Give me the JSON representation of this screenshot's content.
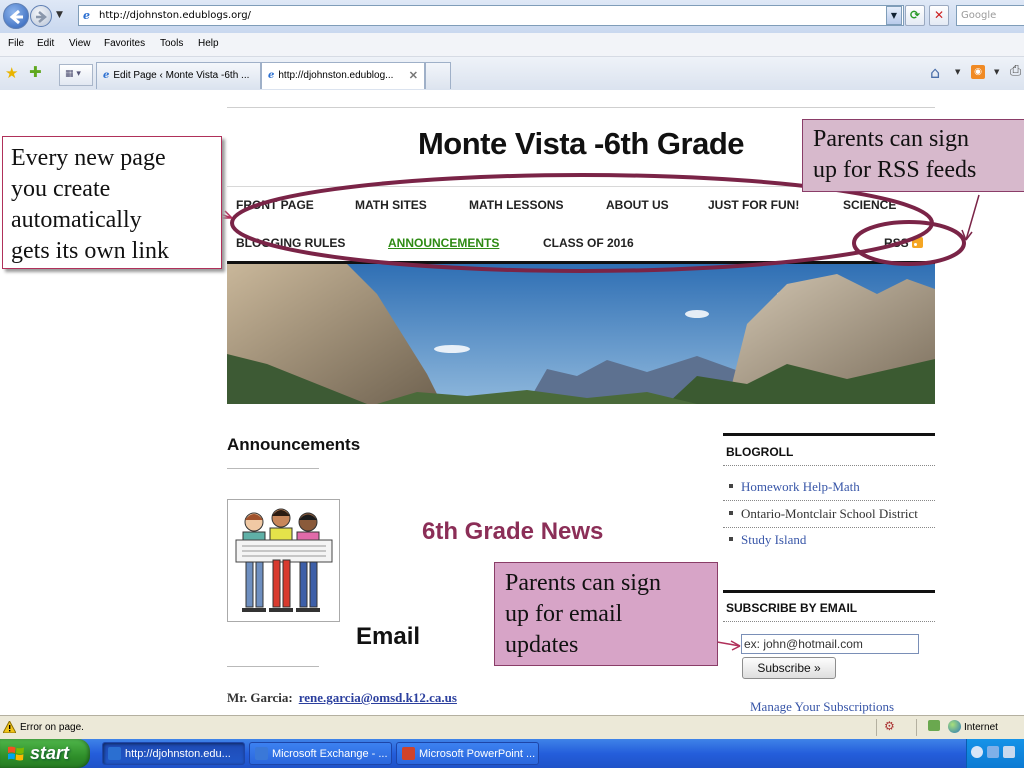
{
  "browser": {
    "url": "http://djohnston.edublogs.org/",
    "search_placeholder": "Google",
    "menu": [
      "File",
      "Edit",
      "View",
      "Favorites",
      "Tools",
      "Help"
    ],
    "tabs": [
      {
        "label": "Edit Page ‹ Monte Vista -6th ..."
      },
      {
        "label": "http://djohnston.edublog..."
      }
    ],
    "status_text": "Error on page.",
    "zone_text": "Internet"
  },
  "site": {
    "title": "Monte Vista -6th Grade",
    "nav_row1": [
      "FRONT PAGE",
      "MATH SITES",
      "MATH LESSONS",
      "ABOUT US",
      "JUST FOR FUN!",
      "SCIENCE"
    ],
    "nav_row2": [
      "BLOGGING RULES",
      "ANNOUNCEMENTS",
      "CLASS OF 2016"
    ],
    "nav_active": "ANNOUNCEMENTS",
    "rss_label": "RSS",
    "section_title": "Announcements",
    "news_title": "6th Grade News",
    "email_title": "Email",
    "contact_name": "Mr. Garcia:",
    "contact_email": "rene.garcia@omsd.k12.ca.us"
  },
  "sidebar": {
    "blogroll_title": "BLOGROLL",
    "blogroll": [
      {
        "label": "Homework Help-Math",
        "link": true
      },
      {
        "label": "Ontario-Montclair School District",
        "link": false
      },
      {
        "label": "Study Island",
        "link": true
      }
    ],
    "subscribe_title": "SUBSCRIBE BY EMAIL",
    "email_placeholder": "ex: john@hotmail.com",
    "subscribe_button": "Subscribe »",
    "manage_link": "Manage Your Subscriptions"
  },
  "callouts": {
    "left": [
      "Every new page",
      "you create",
      "automatically",
      "gets its own link"
    ],
    "rss": [
      "Parents can sign",
      "up for RSS feeds"
    ],
    "email": [
      "Parents can sign",
      "up for email",
      "updates"
    ]
  },
  "taskbar": {
    "start_label": "start",
    "tasks": [
      {
        "label": "http://djohnston.edu...",
        "icon_color": "#2b6fd1"
      },
      {
        "label": "Microsoft Exchange - ...",
        "icon_color": "#3a78d8"
      },
      {
        "label": "Microsoft PowerPoint ...",
        "icon_color": "#d0432a"
      }
    ]
  },
  "colors": {
    "nav_active": "#2e8b14",
    "news_title": "#8b2e57",
    "annotation_ellipse": "#7a2447",
    "callout_fill": "#d7a4c7",
    "link": "#3856a8"
  }
}
